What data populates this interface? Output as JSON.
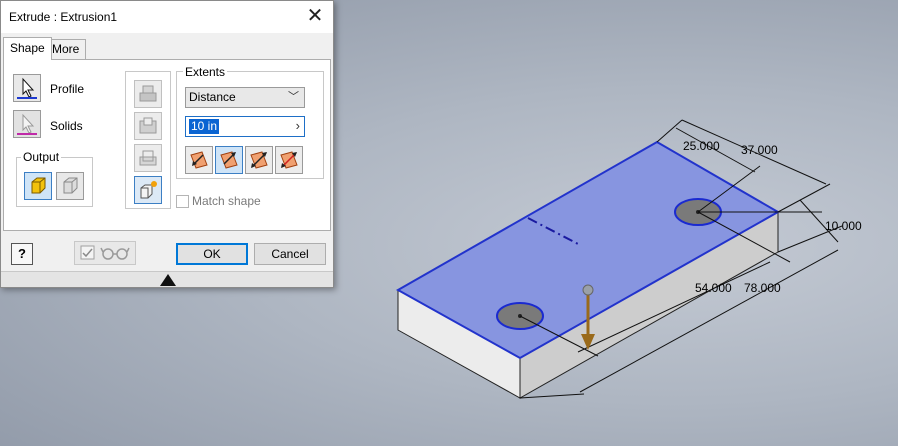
{
  "dialog": {
    "title": "Extrude : Extrusion1",
    "close_icon": "close-icon",
    "tabs": [
      {
        "label": "Shape",
        "active": true
      },
      {
        "label": "More",
        "active": false
      }
    ],
    "profile_label": "Profile",
    "solids_label": "Solids",
    "output_label": "Output",
    "extents": {
      "label": "Extents",
      "selected_option": "Distance",
      "distance_value": "10 in"
    },
    "match_shape_label": "Match shape",
    "match_shape_checked": false,
    "ok_label": "OK",
    "cancel_label": "Cancel",
    "help_label": "?"
  },
  "model": {
    "dimensions": [
      "25.000",
      "37.000",
      "10.000",
      "54.000",
      "78.000"
    ],
    "face_color": "#8795e0",
    "edge_color": "#2233cc",
    "arrow_color": "#9a6a1a"
  }
}
